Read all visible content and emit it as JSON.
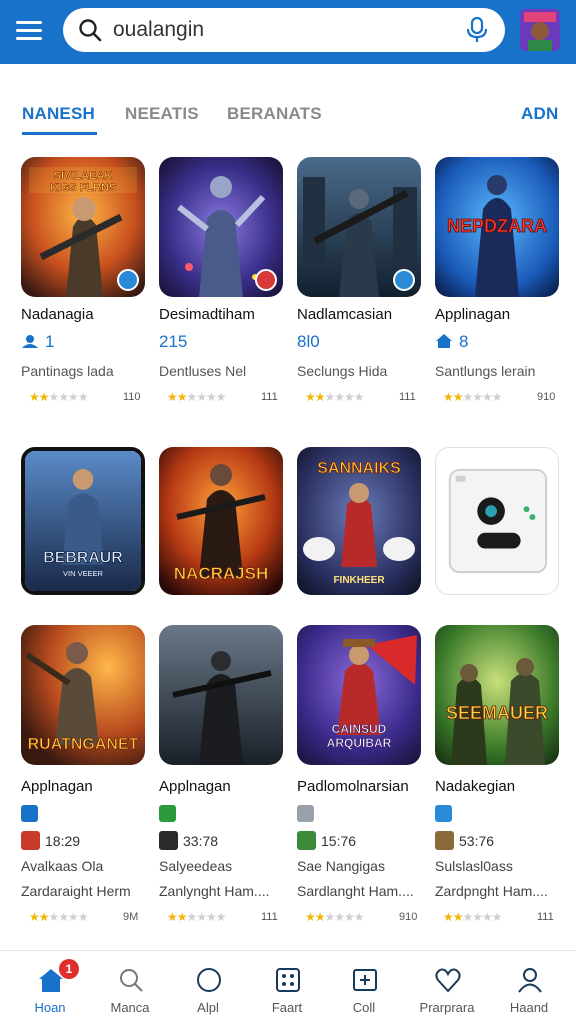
{
  "search": {
    "value": "oualangin"
  },
  "tabs": [
    {
      "label": "NANESH",
      "active": true
    },
    {
      "label": "NEEATIS",
      "active": false
    },
    {
      "label": "BERANATS",
      "active": false
    }
  ],
  "tabs_more": "ADN",
  "row1": [
    {
      "title": "Nadanagia",
      "stat": "1",
      "stat_icon": "person-icon",
      "sub": "Pantinags lada",
      "stars": 2,
      "count": "110",
      "art_text": "SIVILAEAK KIGS FLRNS"
    },
    {
      "title": "Desimadtiham",
      "stat": "215",
      "stat_icon": "pin-icon",
      "sub": "Dentluses Nel",
      "stars": 2,
      "count": "111"
    },
    {
      "title": "Nadlamcasian",
      "stat": "8l0",
      "stat_icon": "pin-icon",
      "sub": "Seclungs Hida",
      "stars": 2,
      "count": "111"
    },
    {
      "title": "Applinagan",
      "stat": "8",
      "stat_icon": "home-icon",
      "sub": "Santlungs lerain",
      "stars": 2,
      "count": "910",
      "art_text": "NEPDZARA"
    }
  ],
  "row2": [
    {
      "art_text": "BEBRAUR",
      "art_sub": "VIN VEEER"
    },
    {
      "art_text": "NACRAJSH"
    },
    {
      "art_text": "SANNAIKS",
      "art_sub": "FINKHEER"
    },
    {
      "art_text": ""
    }
  ],
  "row3": [
    {
      "title": "Applnagan",
      "mini_icon_color": "#1872c9",
      "price": "18:29",
      "line1": "Avalkaas Ola",
      "line2": "Zardaraight Herm",
      "stars": 2,
      "count": "9M",
      "art_text": "RUATNGANET"
    },
    {
      "title": "Applnagan",
      "mini_icon_color": "#2a9a3a",
      "price": "33:78",
      "line1": "Salyeedeas",
      "line2": "Zanlynght Ham....",
      "stars": 2,
      "count": "111"
    },
    {
      "title": "Padlomolnarsian",
      "mini_icon_color": "#9aa0aa",
      "price": "15:76",
      "line1": "Sae Nangigas",
      "line2": "Sardlanght Ham....",
      "stars": 2,
      "count": "910",
      "art_text": "CAINSUD ARQUIBAR"
    },
    {
      "title": "Nadakegian",
      "mini_icon_color": "#2a8ad8",
      "price": "53:76",
      "line1": "Sulslasl0ass",
      "line2": "Zardpnght Ham....",
      "stars": 2,
      "count": "111",
      "art_text": "SEEMAUER"
    }
  ],
  "bottom_nav": [
    {
      "label": "Hoan",
      "icon": "home-icon",
      "active": true,
      "badge": "1"
    },
    {
      "label": "Manca",
      "icon": "search-icon",
      "active": false
    },
    {
      "label": "Alpl",
      "icon": "circle-icon",
      "active": false
    },
    {
      "label": "Faart",
      "icon": "grid-icon",
      "active": false
    },
    {
      "label": "Coll",
      "icon": "add-box-icon",
      "active": false
    },
    {
      "label": "Prarprara",
      "icon": "heart-icon",
      "active": false
    },
    {
      "label": "Haand",
      "icon": "profile-icon",
      "active": false
    }
  ],
  "colors": {
    "primary": "#1872c9",
    "star": "#f2b705",
    "badge": "#e02d2d"
  }
}
